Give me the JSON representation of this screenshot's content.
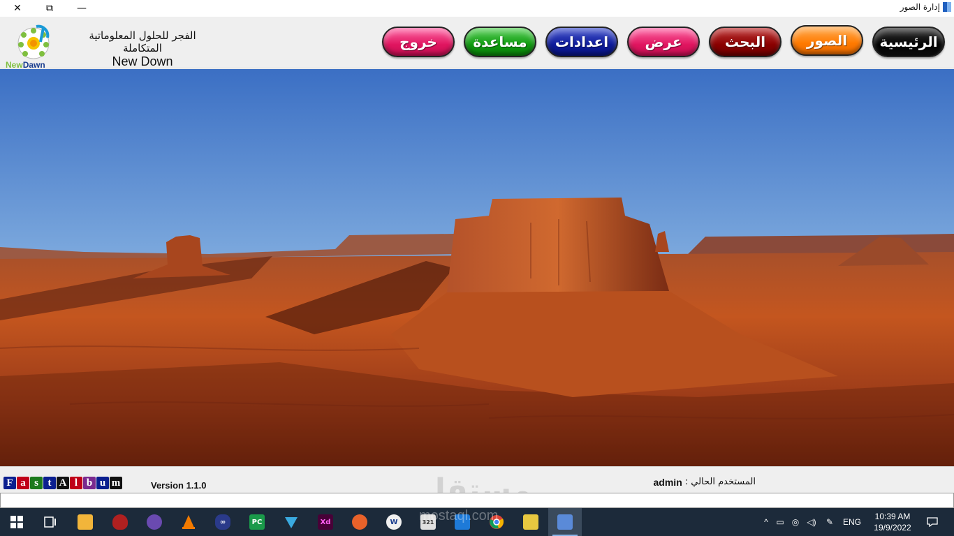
{
  "window": {
    "title": "إدارة الصور",
    "controls": {
      "close": "✕",
      "maximize": "⧉",
      "minimize": "—"
    }
  },
  "header": {
    "logo_new": "New",
    "logo_dawn": "Dawn",
    "company_ar": "الفجر للحلول المعلوماتية المتكاملة",
    "company_en": "New Down"
  },
  "nav": {
    "home": "الرئيسية",
    "photos": "الصور",
    "search": "البحث",
    "view": "عرض",
    "settings": "اعدادات",
    "help": "مساعدة",
    "exit": "خروج"
  },
  "photo": {
    "subject": "desert-mesa"
  },
  "status": {
    "brand_letters": [
      "F",
      "a",
      "s",
      "t",
      "A",
      "l",
      "b",
      "u",
      "m"
    ],
    "brand_colors": [
      "#0b1f8f",
      "#c00018",
      "#1c7a1c",
      "#0b1f8f",
      "#111111",
      "#c00018",
      "#7a2a8f",
      "#0b1f8f",
      "#111111"
    ],
    "version": "Version 1.1.0",
    "current_user_label": "المستخدم الحالي :",
    "current_user_value": "admin",
    "watermark": "مستقل"
  },
  "taskbar": {
    "apps": [
      {
        "name": "start-icon",
        "label": "",
        "color": "#1c2a3a"
      },
      {
        "name": "task-view-icon",
        "label": "",
        "color": "#1c2a3a"
      },
      {
        "name": "file-explorer-icon",
        "label": "",
        "color": "#f2b53a"
      },
      {
        "name": "security-app-icon",
        "label": "",
        "color": "#b02020"
      },
      {
        "name": "tor-browser-icon",
        "label": "",
        "color": "#6a4ab0"
      },
      {
        "name": "vlc-icon",
        "label": "",
        "color": "#f27a00"
      },
      {
        "name": "infinity-app-icon",
        "label": "",
        "color": "#2a3a8a"
      },
      {
        "name": "pycharm-icon",
        "label": "PC",
        "color": "#1a9a4a"
      },
      {
        "name": "vpn-app-icon",
        "label": "",
        "color": "#3aaae0"
      },
      {
        "name": "adobe-xd-icon",
        "label": "Xd",
        "color": "#470137"
      },
      {
        "name": "firefox-icon",
        "label": "",
        "color": "#e8622a"
      },
      {
        "name": "app-w-icon",
        "label": "W",
        "color": "#f0f0f0"
      },
      {
        "name": "calendar-321-icon",
        "label": "321",
        "color": "#e0e0e0"
      },
      {
        "name": "vscode-icon",
        "label": "",
        "color": "#1e7ad8"
      },
      {
        "name": "chrome-icon",
        "label": "",
        "color": "#e0a020"
      },
      {
        "name": "notes-app-icon",
        "label": "",
        "color": "#e8c840"
      },
      {
        "name": "photo-manager-icon",
        "label": "",
        "color": "#5a8ad8"
      }
    ],
    "watermark": "mostaql.com",
    "language": "ENG",
    "time": "10:39 AM",
    "date": "19/9/2022"
  }
}
